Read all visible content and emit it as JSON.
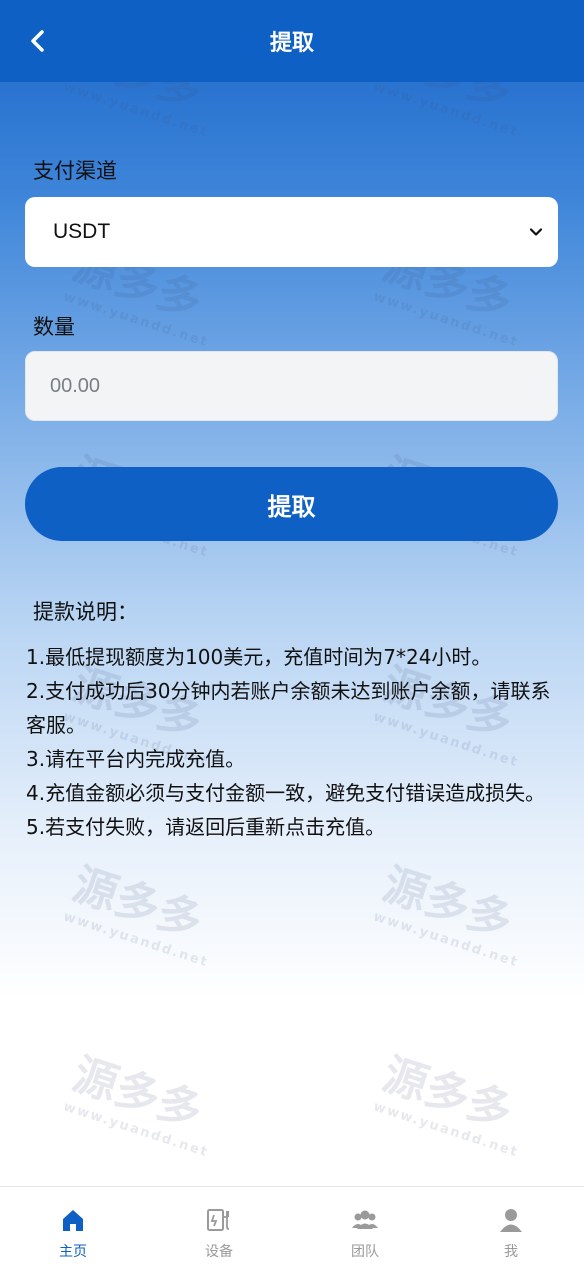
{
  "header": {
    "title": "提取"
  },
  "form": {
    "channel_label": "支付渠道",
    "channel_value": "USDT",
    "amount_label": "数量",
    "amount_placeholder": "00.00",
    "submit_label": "提取"
  },
  "notes": {
    "title": "提款说明：",
    "items": [
      "1.最低提现额度为100美元，充值时间为7*24小时。",
      "2.支付成功后30分钟内若账户余额未达到账户余额，请联系客服。",
      "3.请在平台内完成充值。",
      "4.充值金额必须与支付金额一致，避免支付错误造成损失。",
      "5.若支付失败，请返回后重新点击充值。"
    ]
  },
  "watermark": {
    "text": "源多多",
    "url": "www.yuandd.net"
  },
  "tabbar": {
    "items": [
      {
        "label": "主页",
        "icon": "home-icon",
        "active": true
      },
      {
        "label": "设备",
        "icon": "device-icon",
        "active": false
      },
      {
        "label": "团队",
        "icon": "team-icon",
        "active": false
      },
      {
        "label": "我",
        "icon": "user-icon",
        "active": false
      }
    ]
  },
  "colors": {
    "primary": "#0e60c4",
    "inactive": "#9a9a9a"
  }
}
